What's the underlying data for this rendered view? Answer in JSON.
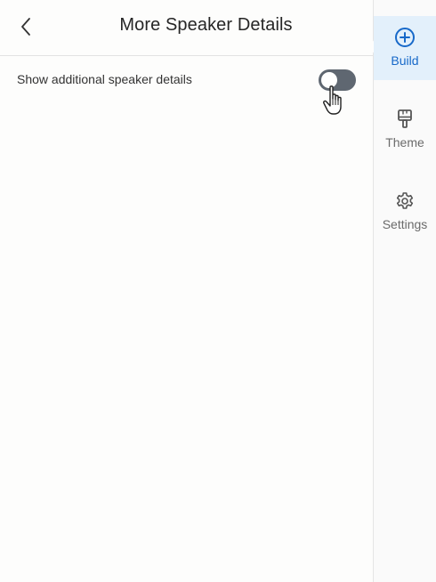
{
  "header": {
    "title": "More Speaker Details",
    "back_icon": "chevron-left-icon"
  },
  "settings": {
    "row_label": "Show additional speaker details",
    "toggle_on": false
  },
  "rail": {
    "items": [
      {
        "label": "Build",
        "icon": "plus-circle-icon",
        "active": true
      },
      {
        "label": "Theme",
        "icon": "paintbrush-icon",
        "active": false
      },
      {
        "label": "Settings",
        "icon": "gear-icon",
        "active": false
      }
    ]
  },
  "colors": {
    "accent": "#1769c9",
    "active_bg": "#e3f0fb",
    "toggle_off": "#5f6771"
  }
}
